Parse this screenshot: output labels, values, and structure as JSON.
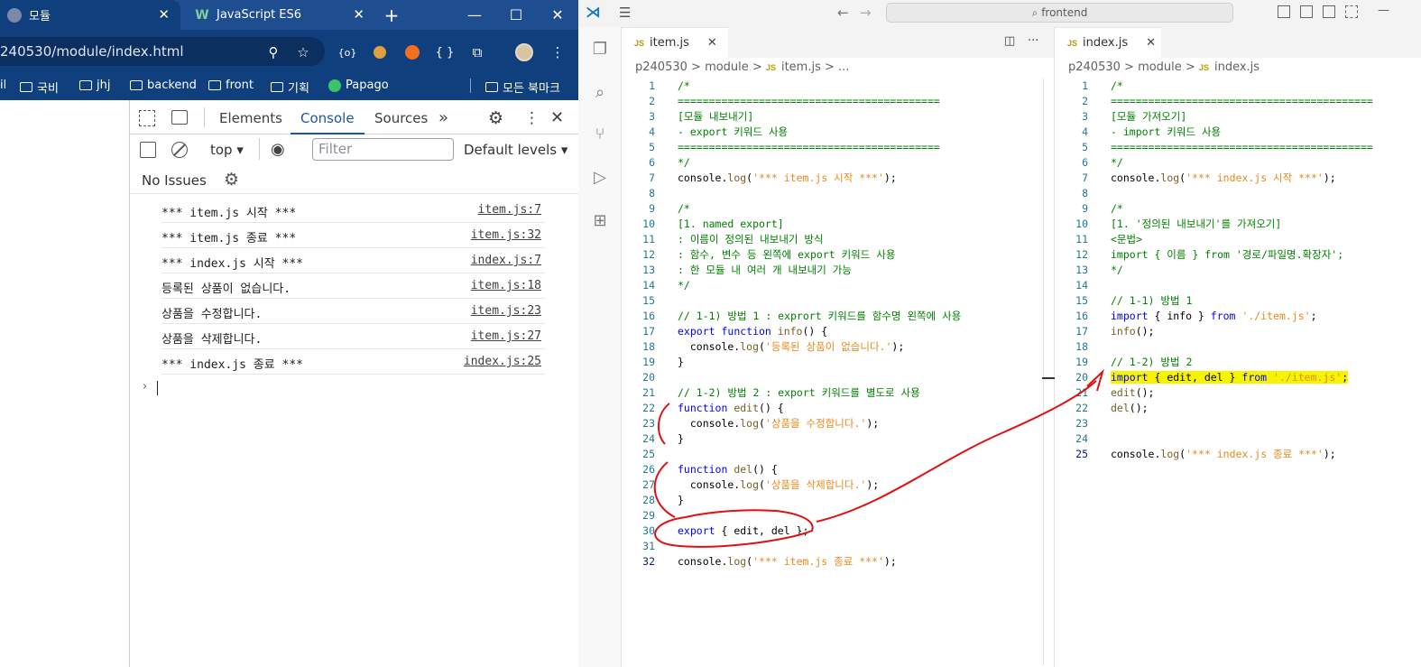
{
  "browser": {
    "tabs": [
      {
        "title": "모듈",
        "favicon": "globe-icon",
        "active": true
      },
      {
        "title": "JavaScript ES6",
        "favicon": "w-site-icon",
        "active": false
      }
    ],
    "url": "240530/module/index.html",
    "bookmarks": [
      "il",
      "국비",
      "jhj",
      "backend",
      "front",
      "기획",
      "Papago",
      "모든 북마크"
    ]
  },
  "devtools": {
    "tabs": [
      "Elements",
      "Console",
      "Sources"
    ],
    "active_tab": "Console",
    "context": "top",
    "filter_placeholder": "Filter",
    "levels": "Default levels",
    "issues": "No Issues",
    "logs": [
      {
        "msg": "*** item.js 시작 ***",
        "src": "item.js:7"
      },
      {
        "msg": "*** item.js 종료 ***",
        "src": "item.js:32"
      },
      {
        "msg": "*** index.js 시작 ***",
        "src": "index.js:7"
      },
      {
        "msg": "등록된 상품이 없습니다.",
        "src": "item.js:18"
      },
      {
        "msg": "상품을 수정합니다.",
        "src": "item.js:23"
      },
      {
        "msg": "상품을 삭제합니다.",
        "src": "item.js:27"
      },
      {
        "msg": "*** index.js 종료 ***",
        "src": "index.js:25"
      }
    ]
  },
  "vscode": {
    "search": "frontend",
    "editors": [
      {
        "tab": "item.js",
        "breadcrumb": [
          "p240530",
          "module",
          "item.js",
          "..."
        ],
        "active_line": 32,
        "lines": [
          [
            {
              "t": "/*",
              "c": "c"
            }
          ],
          [
            {
              "t": "==========================================",
              "c": "c"
            }
          ],
          [
            {
              "t": "[모듈 내보내기]",
              "c": "c"
            }
          ],
          [
            {
              "t": "- export 키워드 사용",
              "c": "c"
            }
          ],
          [
            {
              "t": "==========================================",
              "c": "c"
            }
          ],
          [
            {
              "t": "*/",
              "c": "c"
            }
          ],
          [
            {
              "t": "console.",
              "c": "p"
            },
            {
              "t": "log",
              "c": "f"
            },
            {
              "t": "(",
              "c": "p"
            },
            {
              "t": "'*** item.js 시작 ***'",
              "c": "o"
            },
            {
              "t": ");",
              "c": "p"
            }
          ],
          [],
          [
            {
              "t": "/*",
              "c": "c"
            }
          ],
          [
            {
              "t": "[1. named export]",
              "c": "c"
            }
          ],
          [
            {
              "t": ": 이름이 정의된 내보내기 방식",
              "c": "c"
            }
          ],
          [
            {
              "t": ": 함수, 변수 등 왼쪽에 export 키워드 사용",
              "c": "c"
            }
          ],
          [
            {
              "t": ": 한 모듈 내 여러 개 내보내기 가능",
              "c": "c"
            }
          ],
          [
            {
              "t": "*/",
              "c": "c"
            }
          ],
          [],
          [
            {
              "t": "// 1-1) 방법 1 : exprort 키워드를 함수명 왼쪽에 사용",
              "c": "c"
            }
          ],
          [
            {
              "t": "export ",
              "c": "k"
            },
            {
              "t": "function ",
              "c": "k"
            },
            {
              "t": "info",
              "c": "f"
            },
            {
              "t": "() {",
              "c": "p"
            }
          ],
          [
            {
              "t": "  console.",
              "c": "p"
            },
            {
              "t": "log",
              "c": "f"
            },
            {
              "t": "(",
              "c": "p"
            },
            {
              "t": "'등록된 상품이 없습니다.'",
              "c": "o"
            },
            {
              "t": ");",
              "c": "p"
            }
          ],
          [
            {
              "t": "}",
              "c": "p"
            }
          ],
          [],
          [
            {
              "t": "// 1-2) 방법 2 : export 키워드를 별도로 사용",
              "c": "c"
            }
          ],
          [
            {
              "t": "function ",
              "c": "k"
            },
            {
              "t": "edit",
              "c": "f"
            },
            {
              "t": "() {",
              "c": "p"
            }
          ],
          [
            {
              "t": "  console.",
              "c": "p"
            },
            {
              "t": "log",
              "c": "f"
            },
            {
              "t": "(",
              "c": "p"
            },
            {
              "t": "'상품을 수정합니다.'",
              "c": "o"
            },
            {
              "t": ");",
              "c": "p"
            }
          ],
          [
            {
              "t": "}",
              "c": "p"
            }
          ],
          [],
          [
            {
              "t": "function ",
              "c": "k"
            },
            {
              "t": "del",
              "c": "f"
            },
            {
              "t": "() {",
              "c": "p"
            }
          ],
          [
            {
              "t": "  console.",
              "c": "p"
            },
            {
              "t": "log",
              "c": "f"
            },
            {
              "t": "(",
              "c": "p"
            },
            {
              "t": "'상품을 삭제합니다.'",
              "c": "o"
            },
            {
              "t": ");",
              "c": "p"
            }
          ],
          [
            {
              "t": "}",
              "c": "p"
            }
          ],
          [],
          [
            {
              "t": "export ",
              "c": "k"
            },
            {
              "t": "{ edit, del };",
              "c": "p"
            }
          ],
          [],
          [
            {
              "t": "console.",
              "c": "p"
            },
            {
              "t": "log",
              "c": "f"
            },
            {
              "t": "(",
              "c": "p"
            },
            {
              "t": "'*** item.js 종료 ***'",
              "c": "o"
            },
            {
              "t": ");",
              "c": "p"
            }
          ]
        ]
      },
      {
        "tab": "index.js",
        "breadcrumb": [
          "p240530",
          "module",
          "index.js"
        ],
        "active_line": 25,
        "highlight_line": 20,
        "lines": [
          [
            {
              "t": "/*",
              "c": "c"
            }
          ],
          [
            {
              "t": "==========================================",
              "c": "c"
            }
          ],
          [
            {
              "t": "[모듈 가져오기]",
              "c": "c"
            }
          ],
          [
            {
              "t": "- import 키워드 사용",
              "c": "c"
            }
          ],
          [
            {
              "t": "==========================================",
              "c": "c"
            }
          ],
          [
            {
              "t": "*/",
              "c": "c"
            }
          ],
          [
            {
              "t": "console.",
              "c": "p"
            },
            {
              "t": "log",
              "c": "f"
            },
            {
              "t": "(",
              "c": "p"
            },
            {
              "t": "'*** index.js 시작 ***'",
              "c": "o"
            },
            {
              "t": ");",
              "c": "p"
            }
          ],
          [],
          [
            {
              "t": "/*",
              "c": "c"
            }
          ],
          [
            {
              "t": "[1. '정의된 내보내기'를 가져오기]",
              "c": "c"
            }
          ],
          [
            {
              "t": "<문법>",
              "c": "c"
            }
          ],
          [
            {
              "t": "import { 이름 } from '경로/파일명.확장자';",
              "c": "c"
            }
          ],
          [
            {
              "t": "*/",
              "c": "c"
            }
          ],
          [],
          [
            {
              "t": "// 1-1) 방법 1",
              "c": "c"
            }
          ],
          [
            {
              "t": "import ",
              "c": "k"
            },
            {
              "t": "{ info } ",
              "c": "p"
            },
            {
              "t": "from ",
              "c": "k"
            },
            {
              "t": "'./item.js'",
              "c": "o"
            },
            {
              "t": ";",
              "c": "p"
            }
          ],
          [
            {
              "t": "info",
              "c": "f"
            },
            {
              "t": "();",
              "c": "p"
            }
          ],
          [],
          [
            {
              "t": "// 1-2) 방법 2",
              "c": "c"
            }
          ],
          [
            {
              "t": "import ",
              "c": "k"
            },
            {
              "t": "{ edit, del } ",
              "c": "p"
            },
            {
              "t": "from ",
              "c": "k"
            },
            {
              "t": "'./item.js'",
              "c": "o"
            },
            {
              "t": ";",
              "c": "p"
            }
          ],
          [
            {
              "t": "edit",
              "c": "f"
            },
            {
              "t": "();",
              "c": "p"
            }
          ],
          [
            {
              "t": "del",
              "c": "f"
            },
            {
              "t": "();",
              "c": "p"
            }
          ],
          [],
          [],
          [
            {
              "t": "console.",
              "c": "p"
            },
            {
              "t": "log",
              "c": "f"
            },
            {
              "t": "(",
              "c": "p"
            },
            {
              "t": "'*** index.js 종료 ***'",
              "c": "o"
            },
            {
              "t": ");",
              "c": "p"
            }
          ]
        ]
      }
    ]
  }
}
